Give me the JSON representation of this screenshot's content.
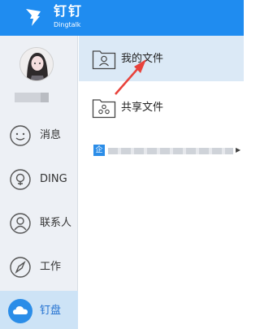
{
  "app": {
    "name_cn": "钉钉",
    "name_en": "Dingtalk"
  },
  "sidebar": {
    "items": [
      {
        "label": "消息",
        "icon": "message-icon",
        "active": false
      },
      {
        "label": "DING",
        "icon": "ding-icon",
        "active": false
      },
      {
        "label": "联系人",
        "icon": "contacts-icon",
        "active": false
      },
      {
        "label": "工作",
        "icon": "work-icon",
        "active": false
      },
      {
        "label": "钉盘",
        "icon": "cloud-drive-icon",
        "active": true
      }
    ]
  },
  "content": {
    "my_files": "我的文件",
    "shared_files": "共享文件",
    "team_badge": "企"
  },
  "colors": {
    "accent": "#1f8cf0",
    "annotation_arrow": "#e8423b"
  }
}
